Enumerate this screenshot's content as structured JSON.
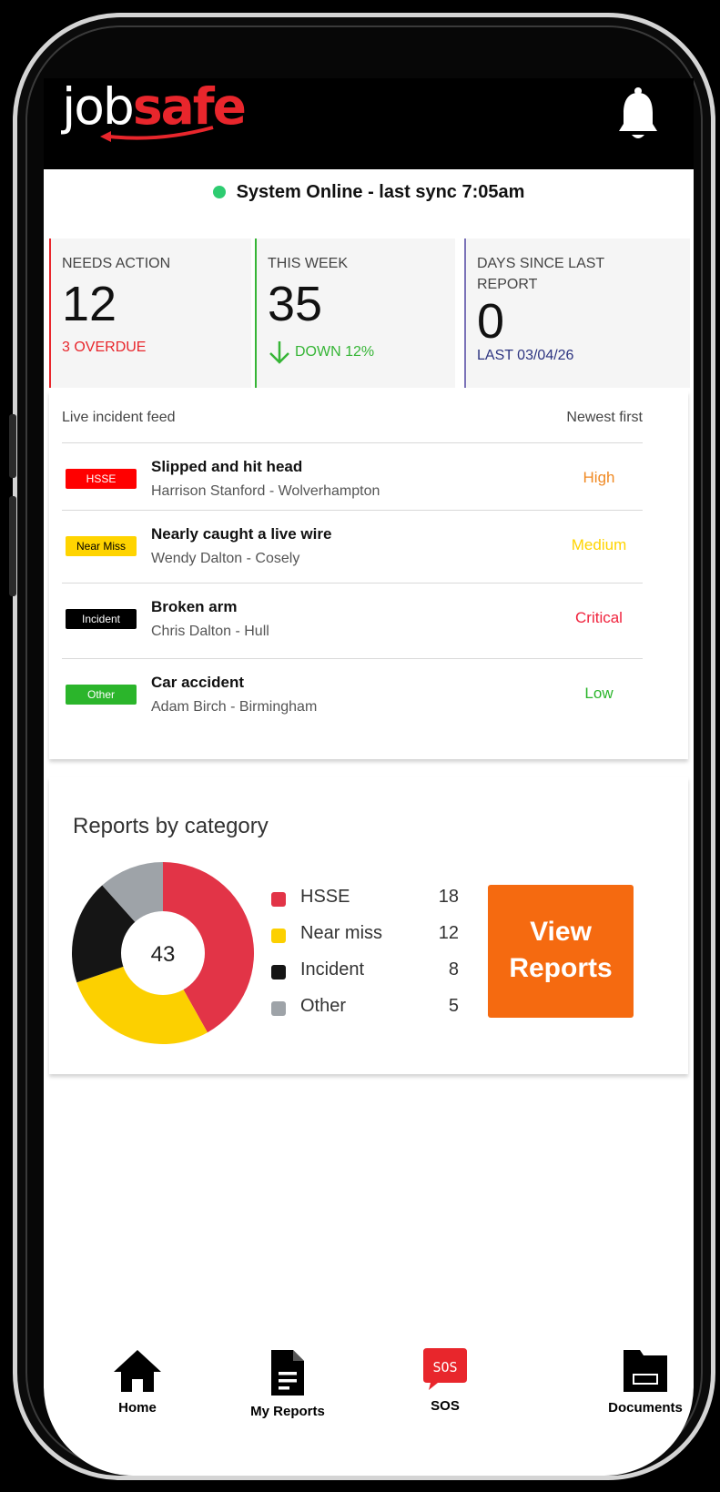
{
  "app": {
    "logo_job": "job",
    "logo_safe": "safe"
  },
  "status": {
    "text": "System Online - last sync 7:05am",
    "color": "#2ecc71"
  },
  "stats": [
    {
      "label": "NEEDS ACTION",
      "value": "12",
      "sub": "3 OVERDUE",
      "accent": "#e8262c",
      "sub_color": "#e8262c"
    },
    {
      "label": "THIS WEEK",
      "value": "35",
      "sub": "DOWN 12%",
      "accent": "#36b536",
      "sub_color": "#36b536",
      "icon": "arrow-down-icon"
    },
    {
      "label": "DAYS SINCE LAST REPORT",
      "value": "0",
      "sub": "LAST 03/04/26",
      "accent": "#7b73b8",
      "sub_color": "#2d3480"
    }
  ],
  "feed": {
    "title": "Live incident feed",
    "sort_label": "Newest first",
    "rows": [
      {
        "badge": "HSSE",
        "badge_bg": "#ff0000",
        "badge_fg": "#ffffff",
        "title": "Slipped and hit head",
        "meta": "Harrison Stanford - Wolverhampton",
        "severity": "High",
        "severity_color": "#f08a24"
      },
      {
        "badge": "Near Miss",
        "badge_bg": "#ffd400",
        "badge_fg": "#000000",
        "title": "Nearly caught a live wire",
        "meta": "Wendy Dalton - Cosely",
        "severity": "Medium",
        "severity_color": "#ffd400"
      },
      {
        "badge": "Incident",
        "badge_bg": "#000000",
        "badge_fg": "#ffffff",
        "title": "Broken arm",
        "meta": "Chris Dalton - Hull",
        "severity": "Critical",
        "severity_color": "#f0233d"
      },
      {
        "badge": "Other",
        "badge_bg": "#2bb52b",
        "badge_fg": "#ffffff",
        "title": "Car accident",
        "meta": "Adam Birch - Birmingham",
        "severity": "Low",
        "severity_color": "#2bb52b"
      }
    ]
  },
  "chart_data": {
    "type": "pie",
    "title": "Reports by category",
    "total": "43",
    "categories": [
      "HSSE",
      "Near miss",
      "Incident",
      "Other"
    ],
    "values": [
      18,
      12,
      8,
      5
    ],
    "colors": [
      "#e23447",
      "#fcd000",
      "#151515",
      "#9ea3a8"
    ]
  },
  "view_button": {
    "line1": "View",
    "line2": "Reports",
    "color": "#f56a10"
  },
  "nav": [
    {
      "label": "Home",
      "icon": "home-icon"
    },
    {
      "label": "My Reports",
      "icon": "document-icon"
    },
    {
      "label": "SOS",
      "icon": "sos-icon",
      "badge": "SOS"
    },
    {
      "label": "Documents",
      "icon": "folder-icon"
    }
  ]
}
